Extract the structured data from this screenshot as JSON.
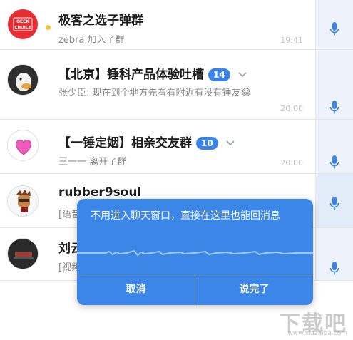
{
  "chats": [
    {
      "name": "极客之选子弹群",
      "message": "zebra 加入了群",
      "time": "19:41",
      "avatar_text": "GEEK CHOICE"
    },
    {
      "name": "【北京】锤科产品体验吐槽",
      "badge": "14",
      "message": "张少臣: 现在到个地方先看看附近有没有锤友😂",
      "time": "20:00"
    },
    {
      "name": "【一锤定姻】相亲交友群",
      "badge": "10",
      "message": "王一一 离开了群",
      "time": "20:00"
    },
    {
      "name": "rubber9soul",
      "message": "[语音"
    },
    {
      "name": "刘云",
      "message": "[视频"
    }
  ],
  "dialog": {
    "text": "不用进入聊天窗口，直接在这里也能回消息",
    "cancel_label": "取消",
    "done_label": "说完了"
  },
  "watermark": {
    "brand": "下载吧",
    "url": "www.xiazaiba.com"
  },
  "colors": {
    "accent": "#3b86e6",
    "badge": "#3a84e9",
    "mic": "#3a84e9",
    "mic_column": "#eef3fb"
  },
  "icons": {
    "mic": "microphone-icon",
    "chevron": "chevron-down-icon"
  }
}
